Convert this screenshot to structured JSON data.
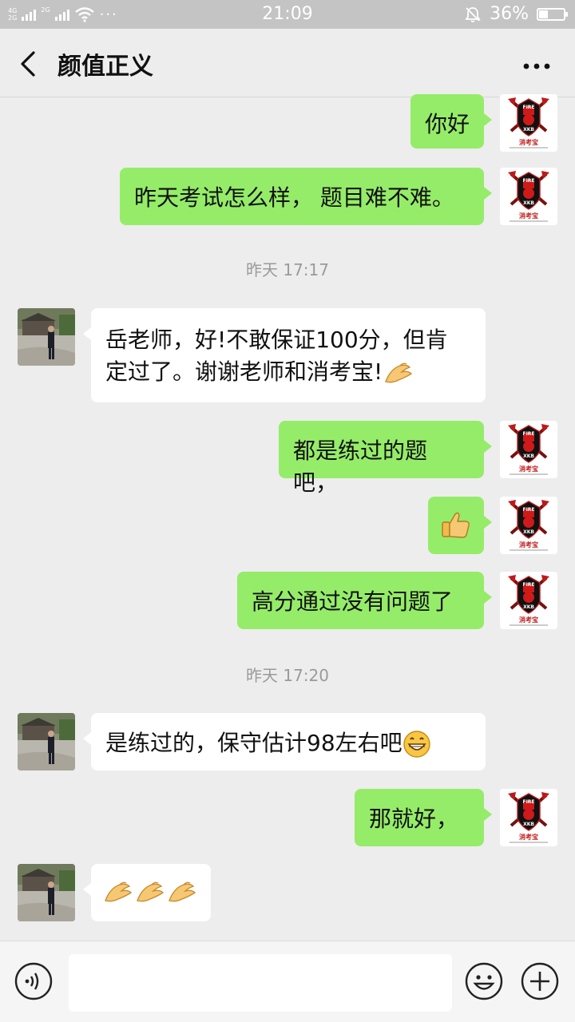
{
  "status_bar": {
    "network_top": "4G",
    "network_bottom": "2G",
    "network_mid": "2G",
    "more": "···",
    "time": "21:09",
    "battery": "36%",
    "battery_level": 0.36
  },
  "header": {
    "title": "颜值正义"
  },
  "messages": [
    {
      "text": "你好"
    },
    {
      "text": "昨天考试怎么样， 题目难不难。"
    },
    {
      "text": "岳老师，好!不敢保证100分，但肯"
    },
    {
      "text": "定过了。谢谢老师和消考宝!"
    },
    {
      "text": "都是练过的题吧，"
    },
    {
      "text": "高分通过没有问题了"
    },
    {
      "text": "是练过的，保守估计98左右吧"
    },
    {
      "text": "那就好，"
    }
  ],
  "timestamps": [
    "昨天 17:17",
    "昨天 17:20"
  ],
  "avatar_me": {
    "line1": "FIRE",
    "line2": "XKB",
    "caption": "消考宝"
  },
  "icons": {
    "back": "chevron-left-icon",
    "more": "more-dots-icon",
    "voice": "voice-icon",
    "emoji": "emoji-icon",
    "plus": "plus-icon"
  }
}
